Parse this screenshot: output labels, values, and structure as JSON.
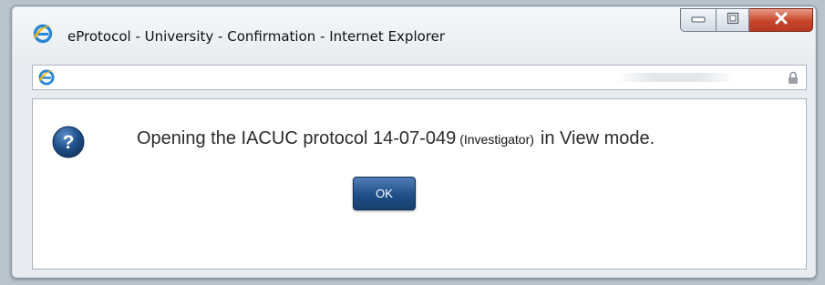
{
  "window": {
    "title": "eProtocol - University - Confirmation - Internet Explorer",
    "controls": {
      "minimize_icon": "minimize-icon",
      "maximize_icon": "maximize-icon",
      "close_icon": "close-icon"
    }
  },
  "address_bar": {
    "site_icon": "ie-icon",
    "security_icon": "lock-icon"
  },
  "dialog": {
    "icon": "question-icon",
    "message_main": "Opening the IACUC protocol 14-07-049",
    "message_role": "(Investigator)",
    "message_end": "in View mode.",
    "ok_label": "OK"
  },
  "colors": {
    "close_button": "#c7452a",
    "ok_button": "#1f4f88",
    "question_icon": "#1f4f88"
  }
}
